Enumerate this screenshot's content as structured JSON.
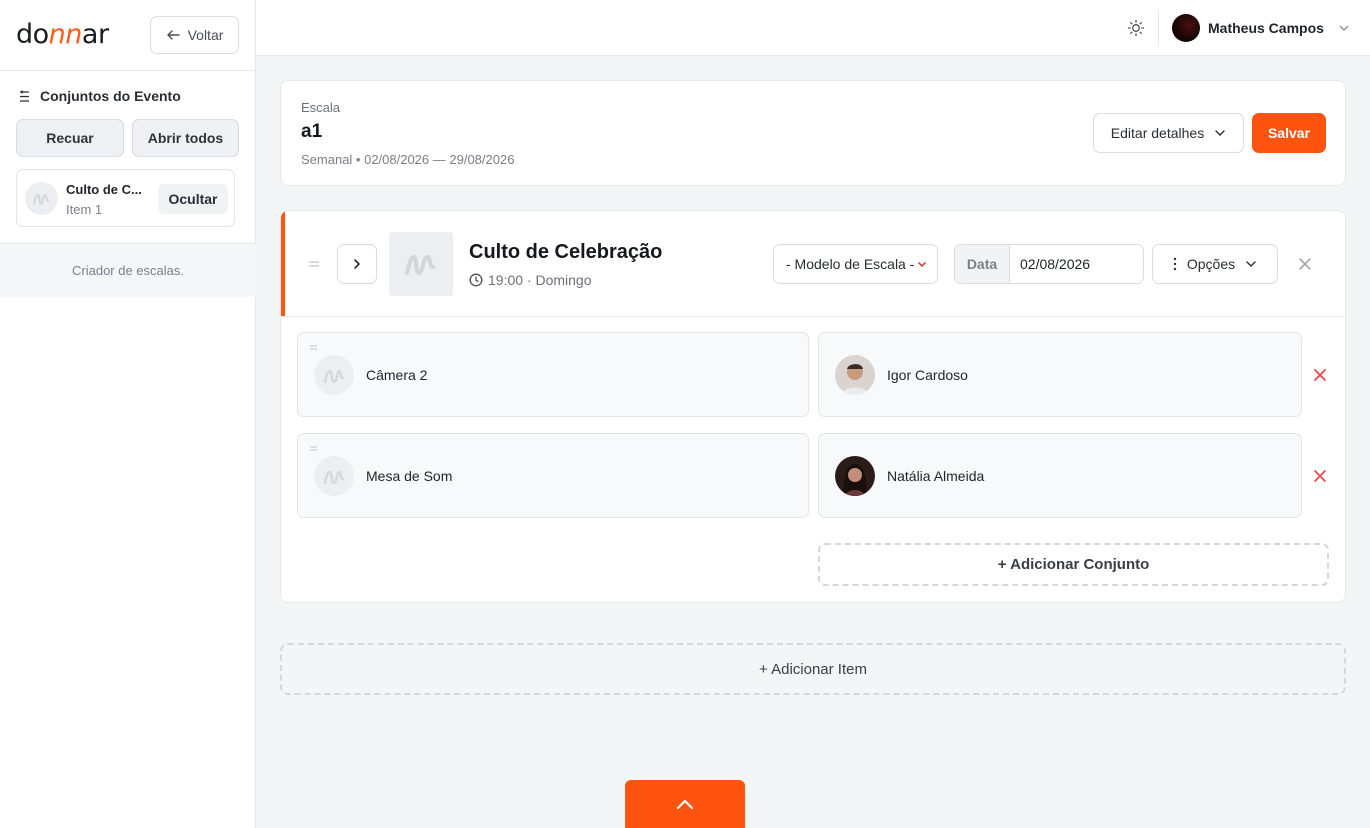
{
  "app": {
    "logo_prefix": "do",
    "logo_accent": "nn",
    "logo_suffix": "ar"
  },
  "sidebar": {
    "back_label": "Voltar",
    "section_title": "Conjuntos do Evento",
    "recuar_label": "Recuar",
    "abrir_todos_label": "Abrir todos",
    "set_card": {
      "title": "Culto de C...",
      "subtitle": "Item 1",
      "hide_label": "Ocultar"
    },
    "footer_text": "Criador de escalas."
  },
  "topbar": {
    "user_name": "Matheus Campos",
    "theme_icon": "sun-icon"
  },
  "escala": {
    "label": "Escala",
    "name": "a1",
    "meta": "Semanal • 02/08/2026 — 29/08/2026",
    "edit_label": "Editar detalhes",
    "save_label": "Salvar"
  },
  "event": {
    "title": "Culto de Celebração",
    "time": "19:00 · Domingo",
    "model_select": "- Modelo de Escala -",
    "date_label": "Data",
    "date_value": "02/08/2026",
    "options_label": "Opções",
    "rows": [
      {
        "role": "Câmera 2",
        "person": "Igor Cardoso"
      },
      {
        "role": "Mesa de Som",
        "person": "Natália Almeida"
      }
    ],
    "add_set_label": "+ Adicionar Conjunto"
  },
  "add_item_label": "+ Adicionar Item",
  "colors": {
    "accent": "#ff5410",
    "danger": "#e5484d"
  }
}
